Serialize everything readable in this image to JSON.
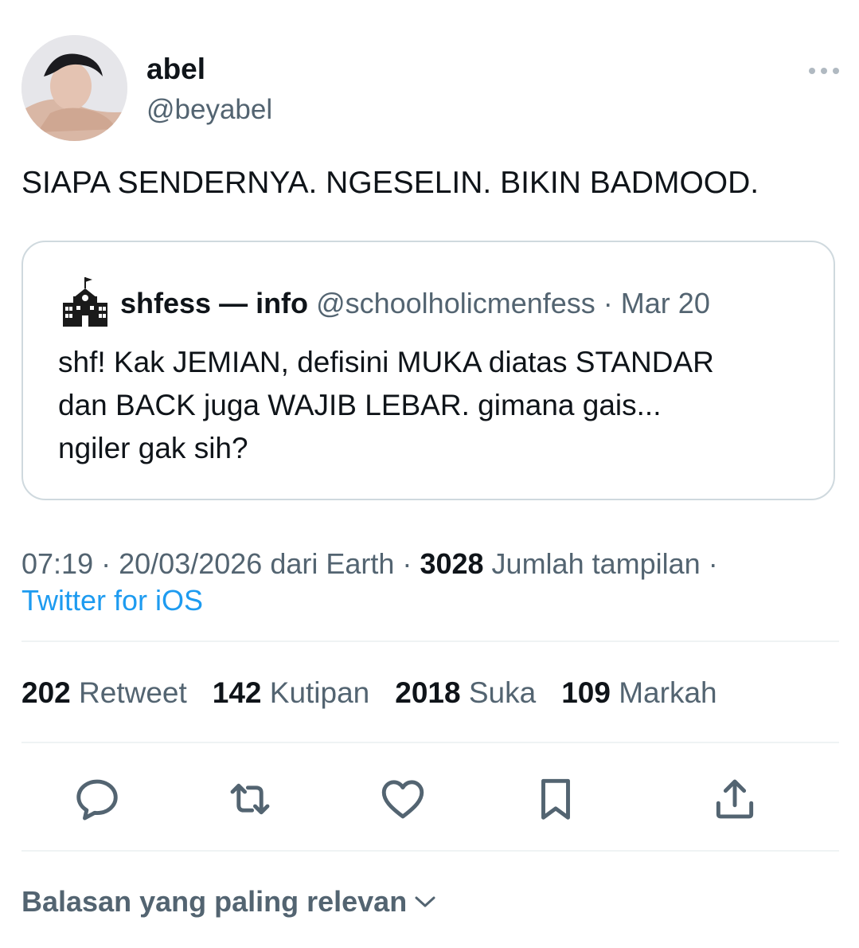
{
  "author": {
    "name": "abel",
    "handle": "@beyabel"
  },
  "tweet": {
    "text": "SIAPA SENDERNYA. NGESELIN. BIKIN BADMOOD."
  },
  "quoted_tweet": {
    "name": "shfess — info",
    "handle": "@schoolholicmenfess",
    "separator": "·",
    "date": "Mar 20",
    "text": "shf! Kak JEMIAN, defisini MUKA diatas STANDAR\ndan BACK juga WAJIB LEBAR. gimana gais...\nngiler gak sih?"
  },
  "meta": {
    "time": "07:19",
    "separator": "·",
    "date": "20/03/2026",
    "location": "dari Earth",
    "views_count": "3028",
    "views_label": "Jumlah tampilan",
    "source": "Twitter for iOS"
  },
  "stats": [
    {
      "count": "202",
      "label": "Retweet"
    },
    {
      "count": "142",
      "label": "Kutipan"
    },
    {
      "count": "2018",
      "label": "Suka"
    },
    {
      "count": "109",
      "label": "Markah"
    }
  ],
  "replies_sort_label": "Balasan yang paling relevan",
  "colors": {
    "text": "#0f1419",
    "secondary": "#536471",
    "link": "#1d9bf0",
    "border": "#cfd9de",
    "divider": "#eff3f4"
  },
  "icons": {
    "more": "more-horizontal-icon",
    "reply": "reply-bubble-icon",
    "retweet": "retweet-icon",
    "like": "heart-icon",
    "bookmark": "bookmark-icon",
    "share": "share-icon",
    "chevron": "chevron-down-icon"
  }
}
